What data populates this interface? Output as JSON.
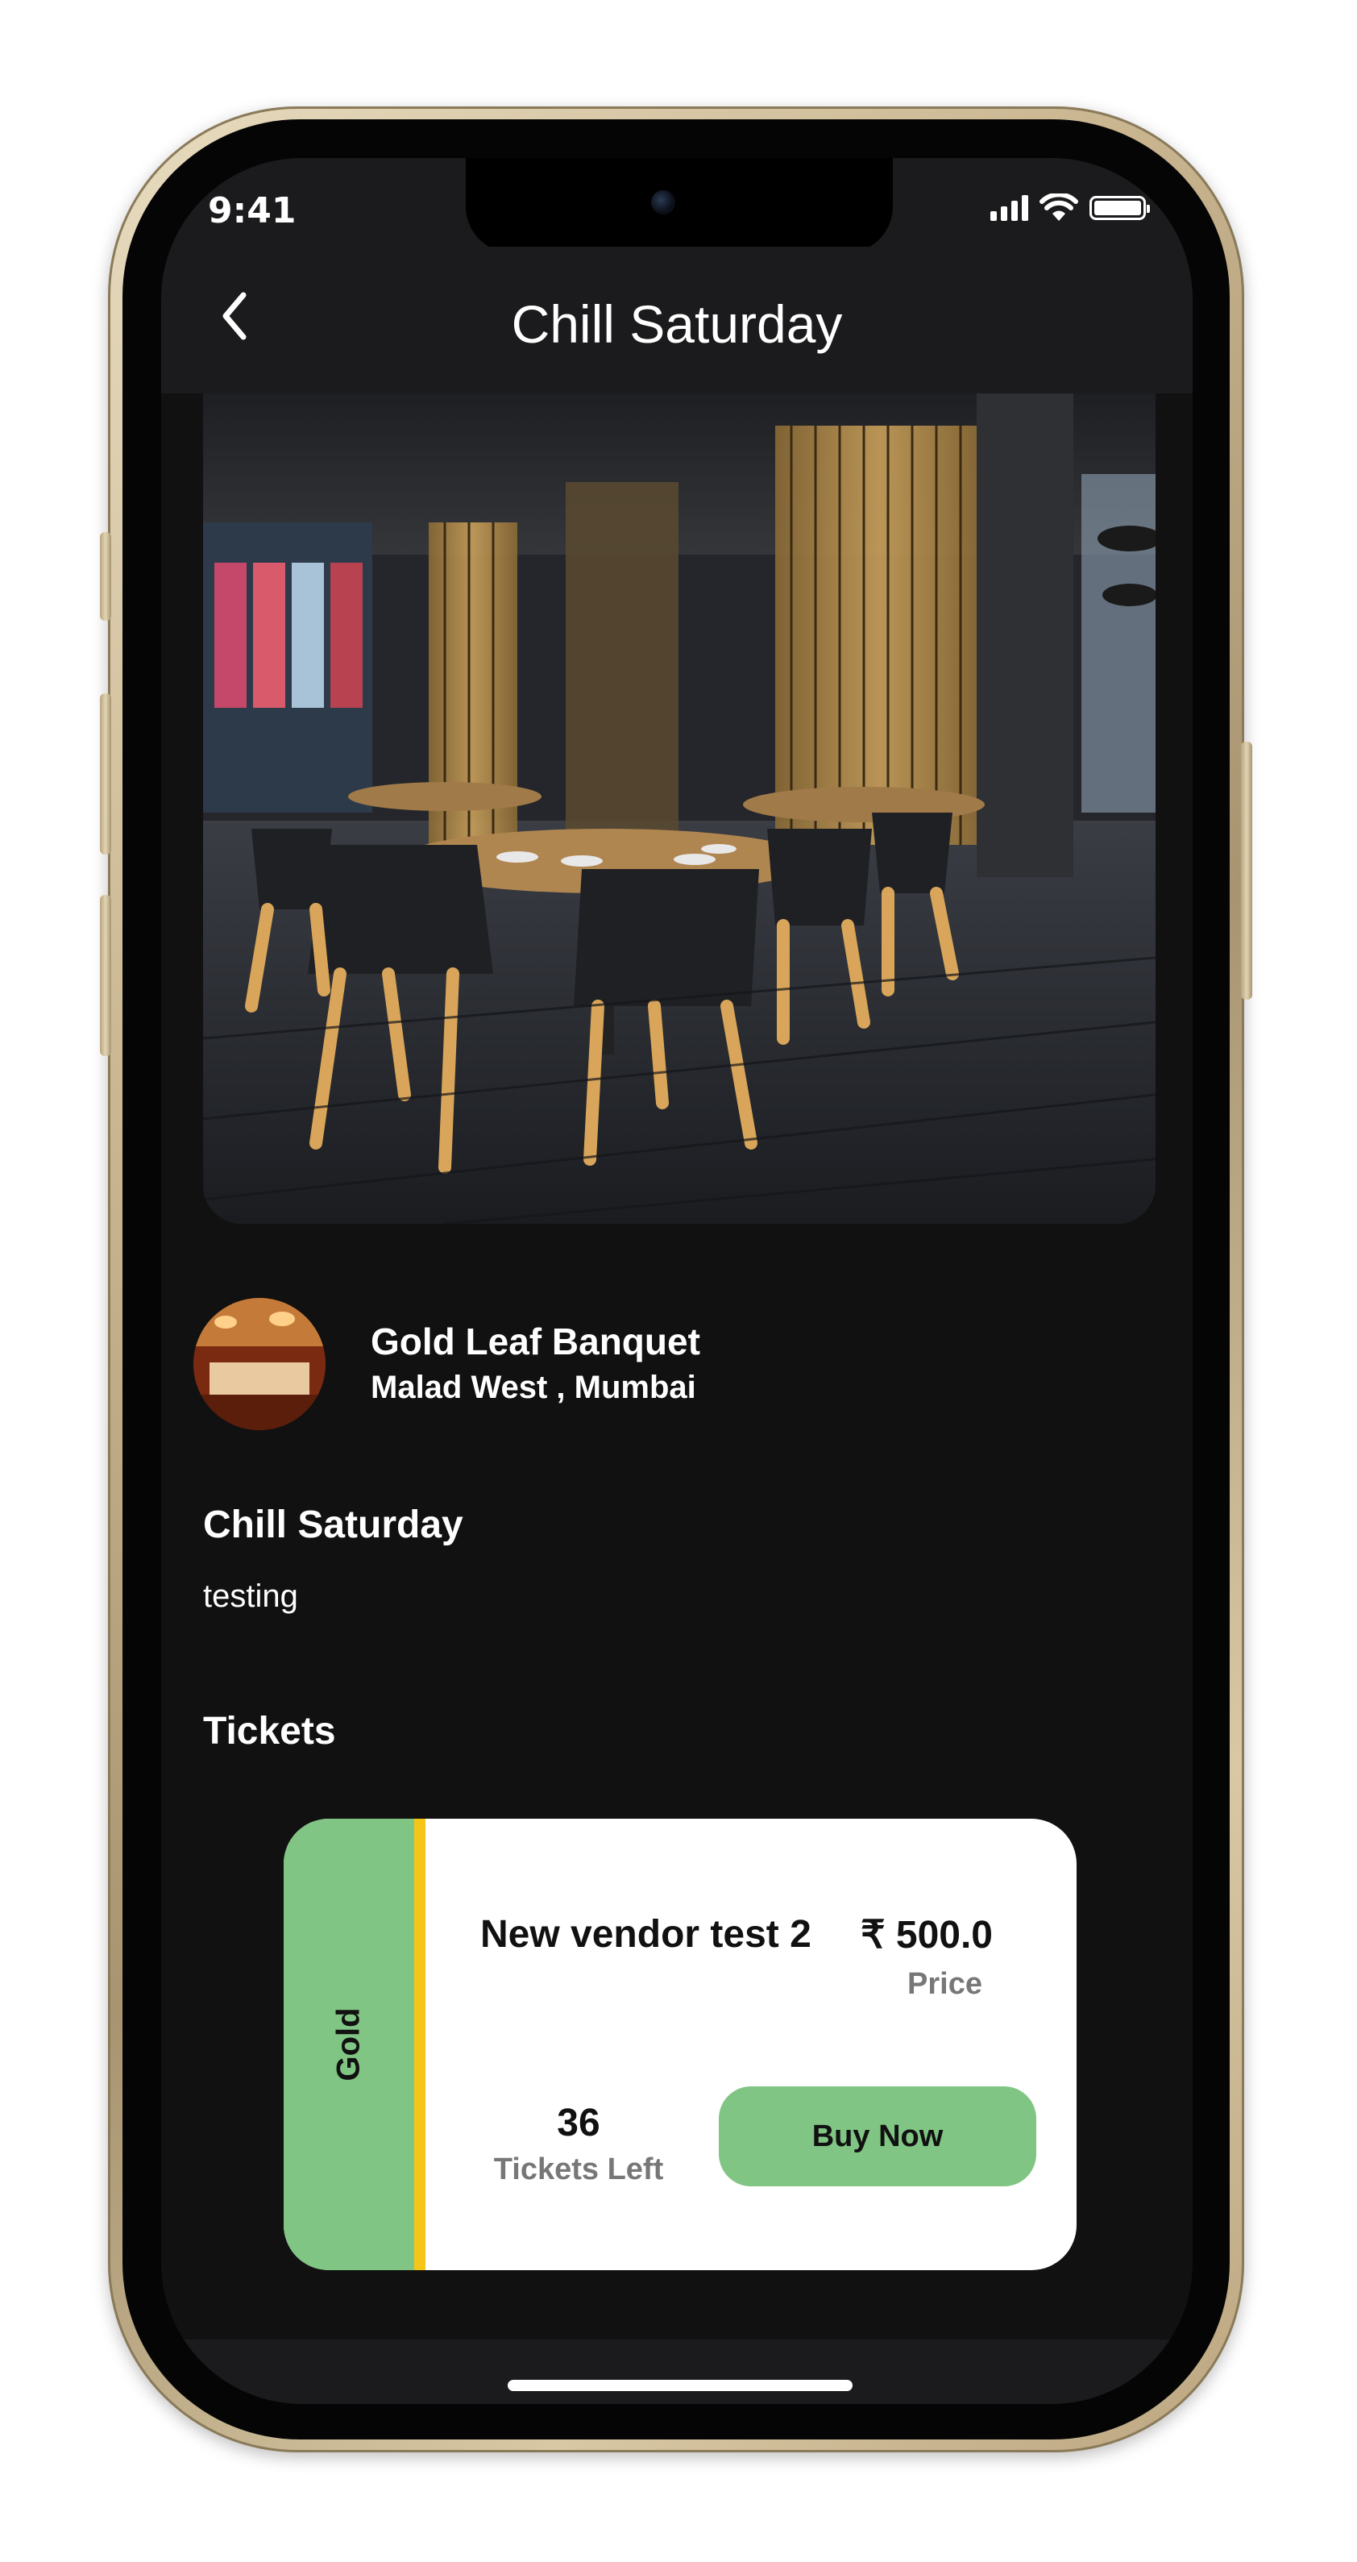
{
  "status_bar": {
    "time": "9:41"
  },
  "header": {
    "title": "Chill Saturday",
    "back_icon": "chevron-left-icon"
  },
  "venue": {
    "name": "Gold Leaf Banquet",
    "location": "Malad West  , Mumbai"
  },
  "event": {
    "title": "Chill Saturday",
    "description": "testing"
  },
  "tickets": {
    "heading": "Tickets",
    "items": [
      {
        "tier": "Gold",
        "name": "New vendor  test 2",
        "price": "₹  500.0",
        "price_label": "Price",
        "tickets_left": "36",
        "tickets_left_label": "Tickets Left",
        "buy_label": "Buy Now"
      }
    ]
  },
  "colors": {
    "background": "#111111",
    "header": "#1b1b1d",
    "accent_green": "#80c583",
    "accent_yellow": "#f5c518",
    "card": "#ffffff"
  }
}
